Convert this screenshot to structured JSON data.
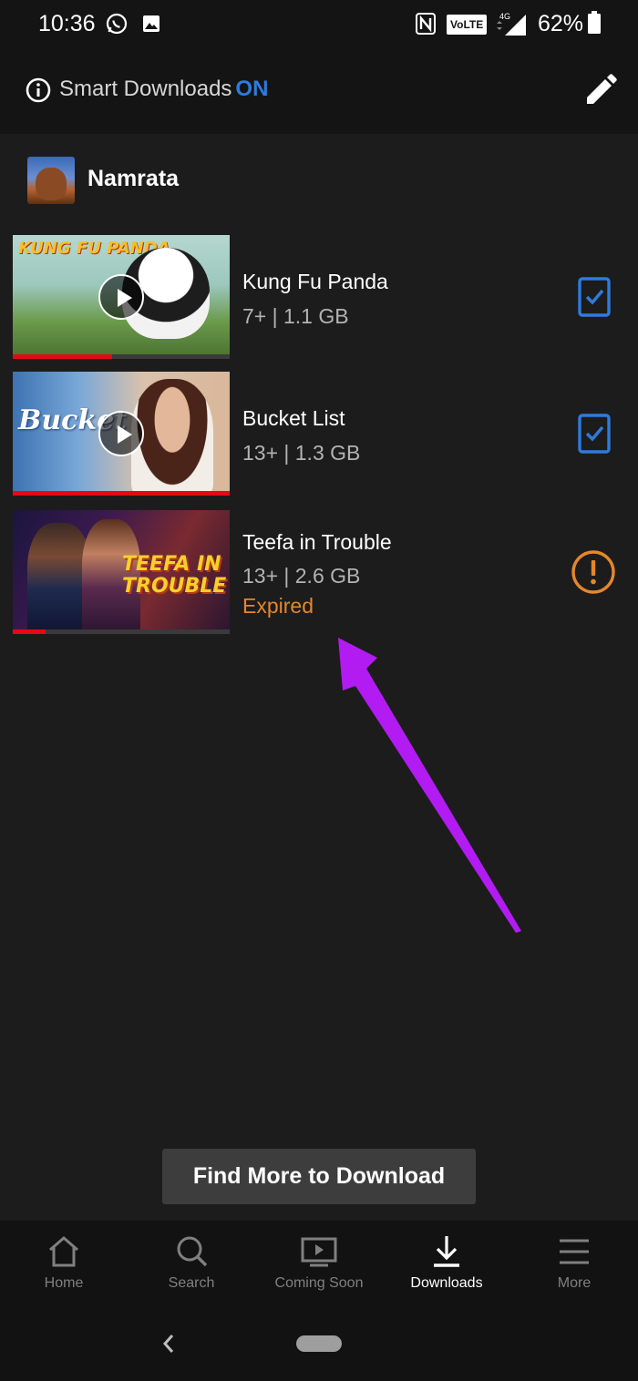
{
  "status_bar": {
    "time": "10:36",
    "volte": "VoLTE",
    "network": "4G",
    "battery": "62%",
    "icons": [
      "whatsapp-icon",
      "image-icon",
      "nfc-icon",
      "signal-icon",
      "battery-icon"
    ]
  },
  "header": {
    "smart_downloads_label": "Smart Downloads",
    "smart_downloads_state": "ON",
    "icons": [
      "info-icon",
      "edit-pencil-icon"
    ]
  },
  "profile": {
    "name": "Namrata"
  },
  "downloads": [
    {
      "title": "Kung Fu Panda",
      "meta": "7+ | 1.1 GB",
      "thumb_text": "KUNG FU PANDA",
      "status": "",
      "progress": 0.46,
      "action_icon": "downloaded-device-icon"
    },
    {
      "title": "Bucket List",
      "meta": "13+ | 1.3 GB",
      "thumb_text": "Bucket List",
      "status": "",
      "progress": 1.0,
      "action_icon": "downloaded-device-icon"
    },
    {
      "title": "Teefa in Trouble",
      "meta": "13+ | 2.6 GB",
      "thumb_text": "TEEFA IN TROUBLE",
      "status": "Expired",
      "progress": 0.15,
      "action_icon": "warning-icon"
    }
  ],
  "find_more_label": "Find More to Download",
  "bottom_nav": [
    {
      "label": "Home",
      "icon": "home-icon",
      "active": false
    },
    {
      "label": "Search",
      "icon": "search-icon",
      "active": false
    },
    {
      "label": "Coming Soon",
      "icon": "coming-soon-icon",
      "active": false
    },
    {
      "label": "Downloads",
      "icon": "downloads-icon",
      "active": true
    },
    {
      "label": "More",
      "icon": "menu-icon",
      "active": false
    }
  ],
  "colors": {
    "accent_blue": "#2e7bdd",
    "netflix_red": "#e50914",
    "expired_orange": "#e4872c",
    "annotation_arrow": "#b21bf2"
  }
}
